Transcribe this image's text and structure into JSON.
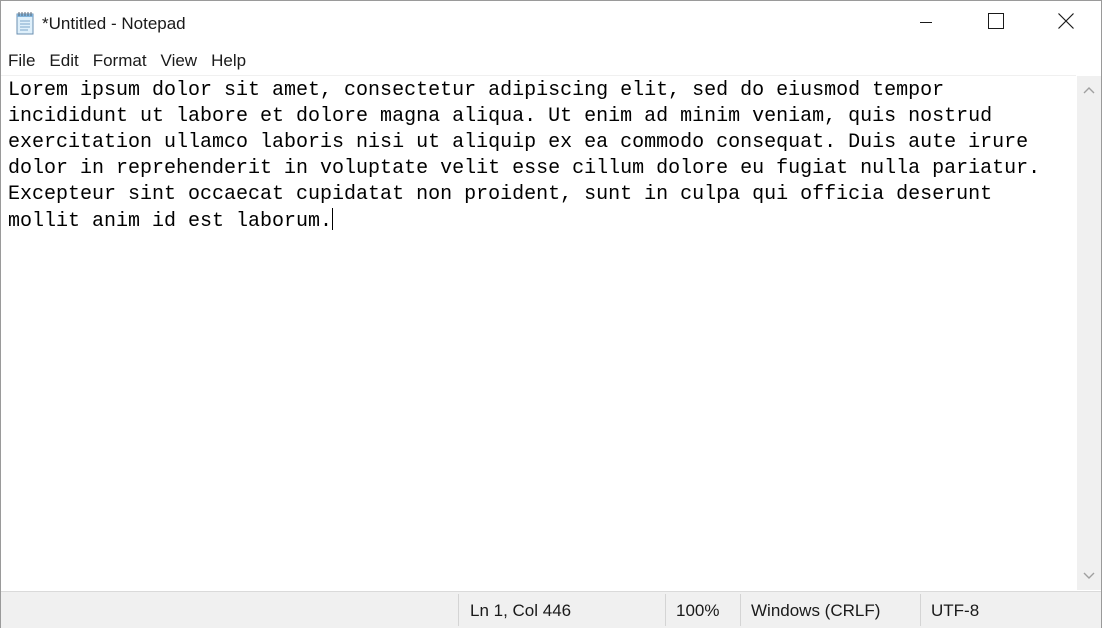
{
  "window": {
    "title": "*Untitled - Notepad",
    "icon": "notepad-icon",
    "controls": {
      "minimize": "minimize-icon",
      "maximize": "maximize-icon",
      "close": "close-icon"
    }
  },
  "menu": {
    "items": [
      "File",
      "Edit",
      "Format",
      "View",
      "Help"
    ]
  },
  "editor": {
    "text": "Lorem ipsum dolor sit amet, consectetur adipiscing elit, sed do eiusmod tempor\nincididunt ut labore et dolore magna aliqua. Ut enim ad minim veniam, quis nostrud\nexercitation ullamco laboris nisi ut aliquip ex ea commodo consequat. Duis aute irure\ndolor in reprehenderit in voluptate velit esse cillum dolore eu fugiat nulla pariatur.\nExcepteur sint occaecat cupidatat non proident, sunt in culpa qui officia deserunt\nmollit anim id est laborum."
  },
  "status": {
    "position": "Ln 1, Col 446",
    "zoom": "100%",
    "line_ending": "Windows (CRLF)",
    "encoding": "UTF-8"
  },
  "colors": {
    "chrome_bg": "#f0f0f0",
    "text": "#000000",
    "window_bg": "#ffffff"
  }
}
